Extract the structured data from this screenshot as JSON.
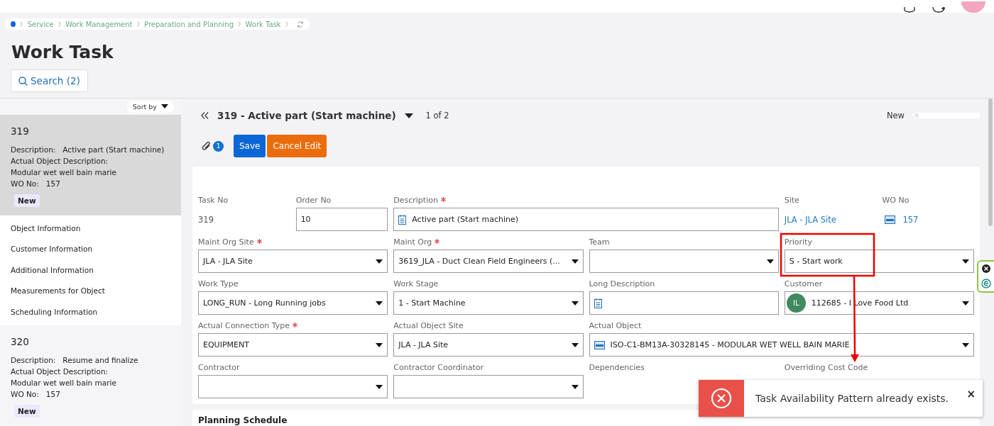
{
  "breadcrumb": [
    "Service",
    "Work Management",
    "Preparation and Planning",
    "Work Task"
  ],
  "page_title": "Work Task",
  "search_button": "Search (2)",
  "sidebar": {
    "sort_label": "Sort by",
    "records": [
      {
        "number": "319",
        "description_label": "Description:",
        "description": "Active part (Start machine)",
        "object_label": "Actual Object Description:",
        "object_description": "Modular wet well bain marie",
        "wo_label": "WO No:",
        "wo_no": "157",
        "status": "New",
        "selected": true,
        "links": [
          "Object Information",
          "Customer Information",
          "Additional Information",
          "Measurements for Object",
          "Scheduling Information"
        ]
      },
      {
        "number": "320",
        "description_label": "Description:",
        "description": "Resume and finalize",
        "object_label": "Actual Object Description:",
        "object_description": "Modular wet well bain marie",
        "wo_label": "WO No:",
        "wo_no": "157",
        "status": "New",
        "selected": false
      }
    ]
  },
  "record_header": {
    "title": "319 - Active part (Start machine)",
    "position": "1 of 2",
    "status": "New"
  },
  "toolbar": {
    "attachment_count": "1",
    "buttons": [
      {
        "label": "Save",
        "kind": "primary"
      },
      {
        "label": "Cancel Edit",
        "kind": "warning"
      }
    ]
  },
  "form": {
    "fields": [
      {
        "label": "Task No",
        "required": false,
        "value": "319",
        "kind": "readonly"
      },
      {
        "label": "Order No",
        "required": false,
        "value": "10",
        "kind": "input"
      },
      {
        "label": "Description",
        "required": true,
        "value": "Active part (Start machine)",
        "kind": "description"
      },
      {
        "label": "Site",
        "required": false,
        "value": "JLA - JLA Site",
        "kind": "link"
      },
      {
        "label": "WO No",
        "required": false,
        "value": "157",
        "kind": "object-link"
      },
      {
        "label": "Maint Org Site",
        "required": true,
        "value": "JLA - JLA Site",
        "kind": "select"
      },
      {
        "label": "Maint Org",
        "required": true,
        "value": "3619_JLA - Duct Clean Field Engineers (...",
        "kind": "select"
      },
      {
        "label": "Team",
        "required": false,
        "kind": "select"
      },
      {
        "label": "Priority",
        "required": false,
        "value": "S - Start work",
        "kind": "select"
      },
      {
        "label": "Work Type",
        "required": false,
        "value": "LONG_RUN - Long Running jobs",
        "kind": "select"
      },
      {
        "label": "Work Stage",
        "required": false,
        "value": "1 - Start Machine",
        "kind": "select"
      },
      {
        "label": "Long Description",
        "required": false,
        "kind": "note"
      },
      {
        "label": "Customer",
        "required": false,
        "value": "112685 - I Love Food Ltd",
        "avatar": "IL",
        "kind": "customer"
      },
      {
        "label": "Actual Connection Type",
        "required": true,
        "value": "EQUIPMENT",
        "kind": "select"
      },
      {
        "label": "Actual Object Site",
        "required": false,
        "value": "JLA - JLA Site",
        "kind": "select"
      },
      {
        "label": "Actual Object",
        "required": false,
        "value": "ISO-C1-BM13A-30328145 - MODULAR WET WELL BAIN MARIE",
        "kind": "object"
      },
      {
        "label": "Contractor",
        "required": false,
        "kind": "select"
      },
      {
        "label": "Contractor Coordinator",
        "required": false,
        "kind": "select"
      },
      {
        "label": "Dependencies",
        "required": false,
        "kind": "label"
      },
      {
        "label": "Overriding Cost Code",
        "required": false,
        "kind": "label"
      }
    ]
  },
  "section_title": "Planning Schedule",
  "toast": {
    "message": "Task Availability Pattern already exists.",
    "close": "×"
  }
}
